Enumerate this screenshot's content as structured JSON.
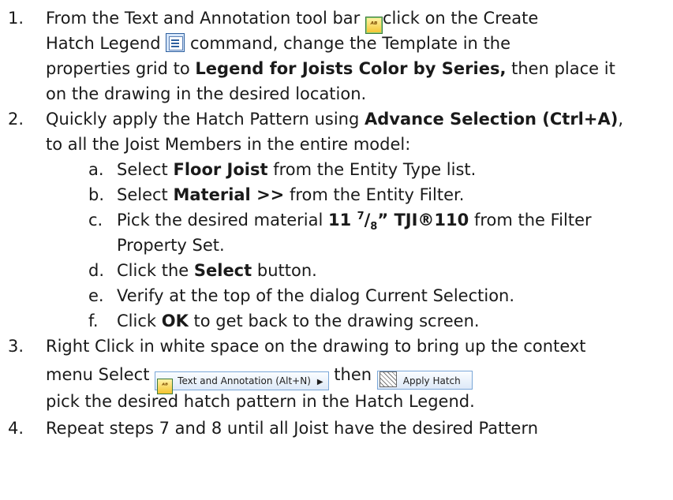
{
  "items": [
    {
      "num": "1.",
      "l1_a": "From the Text and Annotation tool bar",
      "l1_b": "click on the Create",
      "l2_a": "Hatch Legend",
      "l2_b": "command, change the Template in the",
      "l3": "properties grid to",
      "l3_bold": "Legend for Joists Color by Series,",
      "l3_tail": "then place it",
      "l4": "on the drawing in the desired location."
    },
    {
      "num": "2.",
      "l1": "Quickly apply the Hatch Pattern using",
      "l1_bold": "Advance Selection (Ctrl+A)",
      "l1_tail": ",",
      "l2": "to all the Joist Members in the entire model:",
      "sub": [
        {
          "letter": "a.",
          "pre": "Select",
          "bold": "Floor Joist",
          "post": "from the Entity Type list."
        },
        {
          "letter": "b.",
          "pre": "Select",
          "bold": "Material >>",
          "post": "from the Entity Filter."
        },
        {
          "letter": "c.",
          "pre": "Pick the desired material",
          "bold_a": "11",
          "sup": "7",
          "slash": "/",
          "sub": "8",
          "bold_b": "” TJI®110",
          "post": "from the Filter",
          "post2": "Property Set."
        },
        {
          "letter": "d.",
          "pre": "Click the",
          "bold": "Select",
          "post": "button."
        },
        {
          "letter": "e.",
          "pre": "Verify at the top of the dialog Current Selection."
        },
        {
          "letter": "f.",
          "pre": "Click",
          "bold": "OK",
          "post": "to get back to the drawing screen."
        }
      ]
    },
    {
      "num": "3.",
      "l1": "Right Click in white space on the drawing to bring up the context",
      "l2_a": "menu Select",
      "menu_text": "Text and Annotation (Alt+N)",
      "l2_b": "then",
      "hatch_text": "Apply Hatch",
      "l3": "pick the desired hatch pattern in the Hatch Legend."
    },
    {
      "num": "4.",
      "l1": "Repeat steps 7 and 8 until all Joist have the desired Pattern"
    }
  ]
}
